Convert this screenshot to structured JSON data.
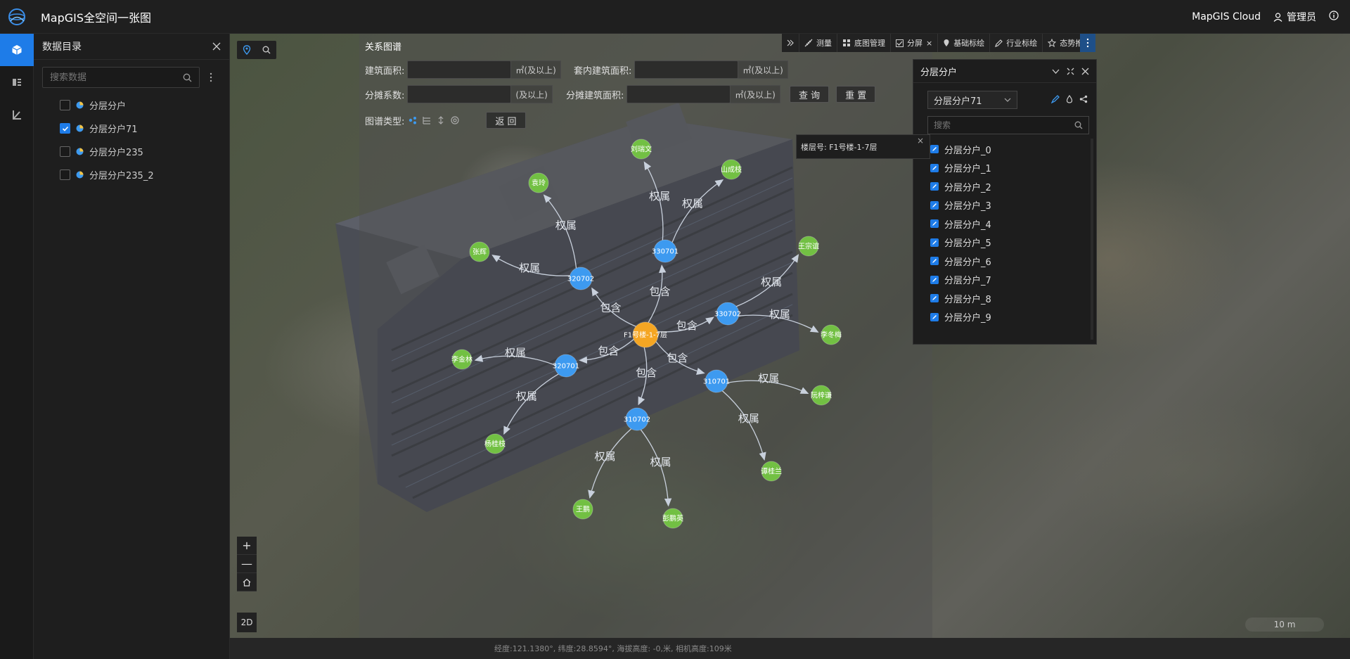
{
  "header": {
    "title": "MapGIS全空间一张图",
    "cloud": "MapGIS Cloud",
    "user": "管理员"
  },
  "catalog": {
    "title": "数据目录",
    "search_placeholder": "搜索数据",
    "items": [
      {
        "label": "分层分户",
        "checked": false
      },
      {
        "label": "分层分户71",
        "checked": true
      },
      {
        "label": "分层分户235",
        "checked": false
      },
      {
        "label": "分层分户235_2",
        "checked": false
      }
    ]
  },
  "graph_panel": {
    "title": "关系图谱",
    "fields": {
      "building_area": "建筑面积:",
      "inner_area": "套内建筑面积:",
      "share_coef": "分摊系数:",
      "share_area": "分摊建筑面积:"
    },
    "units": {
      "area": "㎡(及以上)",
      "coef": "(及以上)"
    },
    "buttons": {
      "query": "查 询",
      "reset": "重 置",
      "back": "返 回"
    },
    "graph_type_label": "图谱类型:"
  },
  "toolbar": {
    "items": [
      "测量",
      "底图管理",
      "分屏",
      "基础标绘",
      "行业标绘",
      "态势推演"
    ]
  },
  "layer_panel": {
    "title": "分层分户",
    "selected": "分层分户71",
    "search_placeholder": "搜索",
    "items": [
      "分层分户_0",
      "分层分户_1",
      "分层分户_2",
      "分层分户_3",
      "分层分户_4",
      "分层分户_5",
      "分层分户_6",
      "分层分户_7",
      "分层分户_8",
      "分层分户_9"
    ]
  },
  "popup": {
    "text": "楼层号: F1号楼-1-7层"
  },
  "graph": {
    "center": "F1号楼-1-7层",
    "rooms": [
      "330701",
      "320702",
      "330702",
      "320701",
      "310701",
      "310702"
    ],
    "owners": [
      "刘瑞文",
      "山成枝",
      "袁玲",
      "张辉",
      "王宗谊",
      "李冬梅",
      "李金林",
      "阮梓谦",
      "杨桂枝",
      "谭桂兰",
      "王鹏",
      "彭鹏英"
    ],
    "edge_contains": "包含",
    "edge_owns": "权属"
  },
  "map": {
    "zoom_in": "+",
    "zoom_out": "—",
    "mode": "2D",
    "scale": "10 m"
  },
  "status": {
    "text": "经度:121.1380°, 纬度:28.8594°, 海拔高度: -0,米, 相机高度:109米"
  },
  "colors": {
    "accent": "#1e7ce8",
    "center_node": "#f5a623",
    "room_node": "#3d9af0",
    "owner_node": "#72c043"
  }
}
